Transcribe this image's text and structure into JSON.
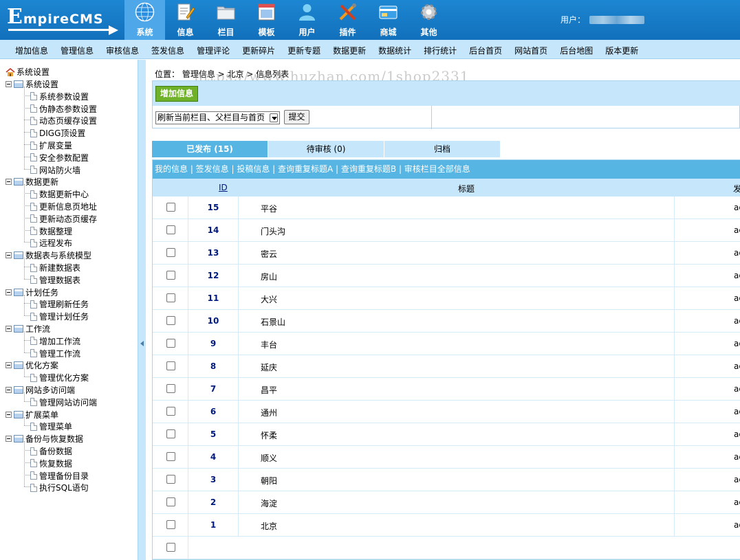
{
  "header": {
    "logo_text": "mpireCMS",
    "logo_initial": "E",
    "user_label": "用户：",
    "nav": [
      {
        "label": "系统",
        "icon": "globe-icon",
        "active": true
      },
      {
        "label": "信息",
        "icon": "notepad-pencil-icon"
      },
      {
        "label": "栏目",
        "icon": "folder-icon"
      },
      {
        "label": "模板",
        "icon": "template-window-icon"
      },
      {
        "label": "用户",
        "icon": "user-icon"
      },
      {
        "label": "插件",
        "icon": "tools-icon"
      },
      {
        "label": "商城",
        "icon": "card-icon"
      },
      {
        "label": "其他",
        "icon": "gear-icon"
      }
    ]
  },
  "submenu": [
    "增加信息",
    "管理信息",
    "审核信息",
    "签发信息",
    "管理评论",
    "更新碎片",
    "更新专题",
    "数据更新",
    "数据统计",
    "排行统计",
    "后台首页",
    "网站首页",
    "后台地图",
    "版本更新"
  ],
  "sidebar": {
    "root": "系统设置",
    "groups": [
      {
        "label": "系统设置",
        "items": [
          "系统参数设置",
          "伪静态参数设置",
          "动态页缓存设置",
          "DIGG顶设置",
          "扩展变量",
          "安全参数配置",
          "网站防火墙"
        ]
      },
      {
        "label": "数据更新",
        "items": [
          "数据更新中心",
          "更新信息页地址",
          "更新动态页缓存",
          "数据整理",
          "远程发布"
        ]
      },
      {
        "label": "数据表与系统模型",
        "items": [
          "新建数据表",
          "管理数据表"
        ]
      },
      {
        "label": "计划任务",
        "items": [
          "管理刷新任务",
          "管理计划任务"
        ]
      },
      {
        "label": "工作流",
        "items": [
          "增加工作流",
          "管理工作流"
        ]
      },
      {
        "label": "优化方案",
        "items": [
          "管理优化方案"
        ]
      },
      {
        "label": "网站多访问端",
        "items": [
          "管理网站访问端"
        ]
      },
      {
        "label": "扩展菜单",
        "items": [
          "管理菜单"
        ]
      },
      {
        "label": "备份与恢复数据",
        "items": [
          "备份数据",
          "恢复数据",
          "管理备份目录",
          "执行SQL语句"
        ]
      }
    ]
  },
  "main": {
    "breadcrumb": "位置： 管理信息 > 北京 > 信息列表",
    "watermark": "https://www.huzhan.com/1shop2331",
    "add_button": "增加信息",
    "refresh_select": "刷新当前栏目、父栏目与首页",
    "submit_button": "提交",
    "tabs": [
      "已发布 (15)",
      "待审核 (0)",
      "归档"
    ],
    "links": "我的信息 | 签发信息 | 投稿信息 | 查询重复标题A | 查询重复标题B | 审核栏目全部信息",
    "columns": {
      "id": "ID",
      "title": "标题",
      "publisher": "发"
    },
    "rows": [
      {
        "id": "15",
        "title": "平谷",
        "pub": "ac"
      },
      {
        "id": "14",
        "title": "门头沟",
        "pub": "ac"
      },
      {
        "id": "13",
        "title": "密云",
        "pub": "ac"
      },
      {
        "id": "12",
        "title": "房山",
        "pub": "ac"
      },
      {
        "id": "11",
        "title": "大兴",
        "pub": "ac"
      },
      {
        "id": "10",
        "title": "石景山",
        "pub": "ac"
      },
      {
        "id": "9",
        "title": "丰台",
        "pub": "ac"
      },
      {
        "id": "8",
        "title": "延庆",
        "pub": "ac"
      },
      {
        "id": "7",
        "title": "昌平",
        "pub": "ac"
      },
      {
        "id": "6",
        "title": "通州",
        "pub": "ac"
      },
      {
        "id": "5",
        "title": "怀柔",
        "pub": "ac"
      },
      {
        "id": "4",
        "title": "顺义",
        "pub": "ac"
      },
      {
        "id": "3",
        "title": "朝阳",
        "pub": "ac"
      },
      {
        "id": "2",
        "title": "海淀",
        "pub": "ac"
      },
      {
        "id": "1",
        "title": "北京",
        "pub": "ac"
      }
    ]
  }
}
